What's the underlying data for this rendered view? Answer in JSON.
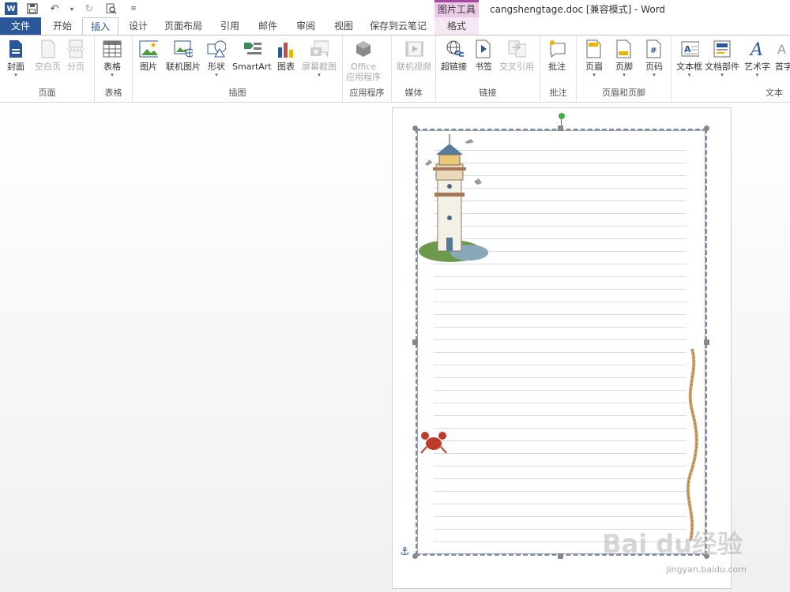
{
  "titlebar": {
    "word_logo": "W",
    "context_tools": "图片工具",
    "doc_title": "cangshengtage.doc [兼容模式] - Word"
  },
  "tabs": [
    "文件",
    "开始",
    "插入",
    "设计",
    "页面布局",
    "引用",
    "邮件",
    "审阅",
    "视图",
    "保存到云笔记",
    "格式"
  ],
  "ribbon": {
    "groups": [
      {
        "label": "页面",
        "buttons": [
          "封面",
          "空白页",
          "分页"
        ]
      },
      {
        "label": "表格",
        "buttons": [
          "表格"
        ]
      },
      {
        "label": "插图",
        "buttons": [
          "图片",
          "联机图片",
          "形状",
          "SmartArt",
          "图表",
          "屏幕截图"
        ]
      },
      {
        "label": "应用程序",
        "buttons": [
          "Office",
          "应用程序"
        ]
      },
      {
        "label": "媒体",
        "buttons": [
          "联机视频"
        ]
      },
      {
        "label": "链接",
        "buttons": [
          "超链接",
          "书签",
          "交叉引用"
        ]
      },
      {
        "label": "批注",
        "buttons": [
          "批注"
        ]
      },
      {
        "label": "页眉和页脚",
        "buttons": [
          "页眉",
          "页脚",
          "页码"
        ]
      },
      {
        "label": "文本",
        "buttons": [
          "文本框",
          "文档部件",
          "艺术字",
          "首字"
        ]
      }
    ]
  },
  "watermark": {
    "brand": "Bai du经验",
    "url": "jingyan.baidu.com"
  },
  "colors": {
    "brand_blue": "#2b579a",
    "context_tab": "#e9c9e6"
  }
}
